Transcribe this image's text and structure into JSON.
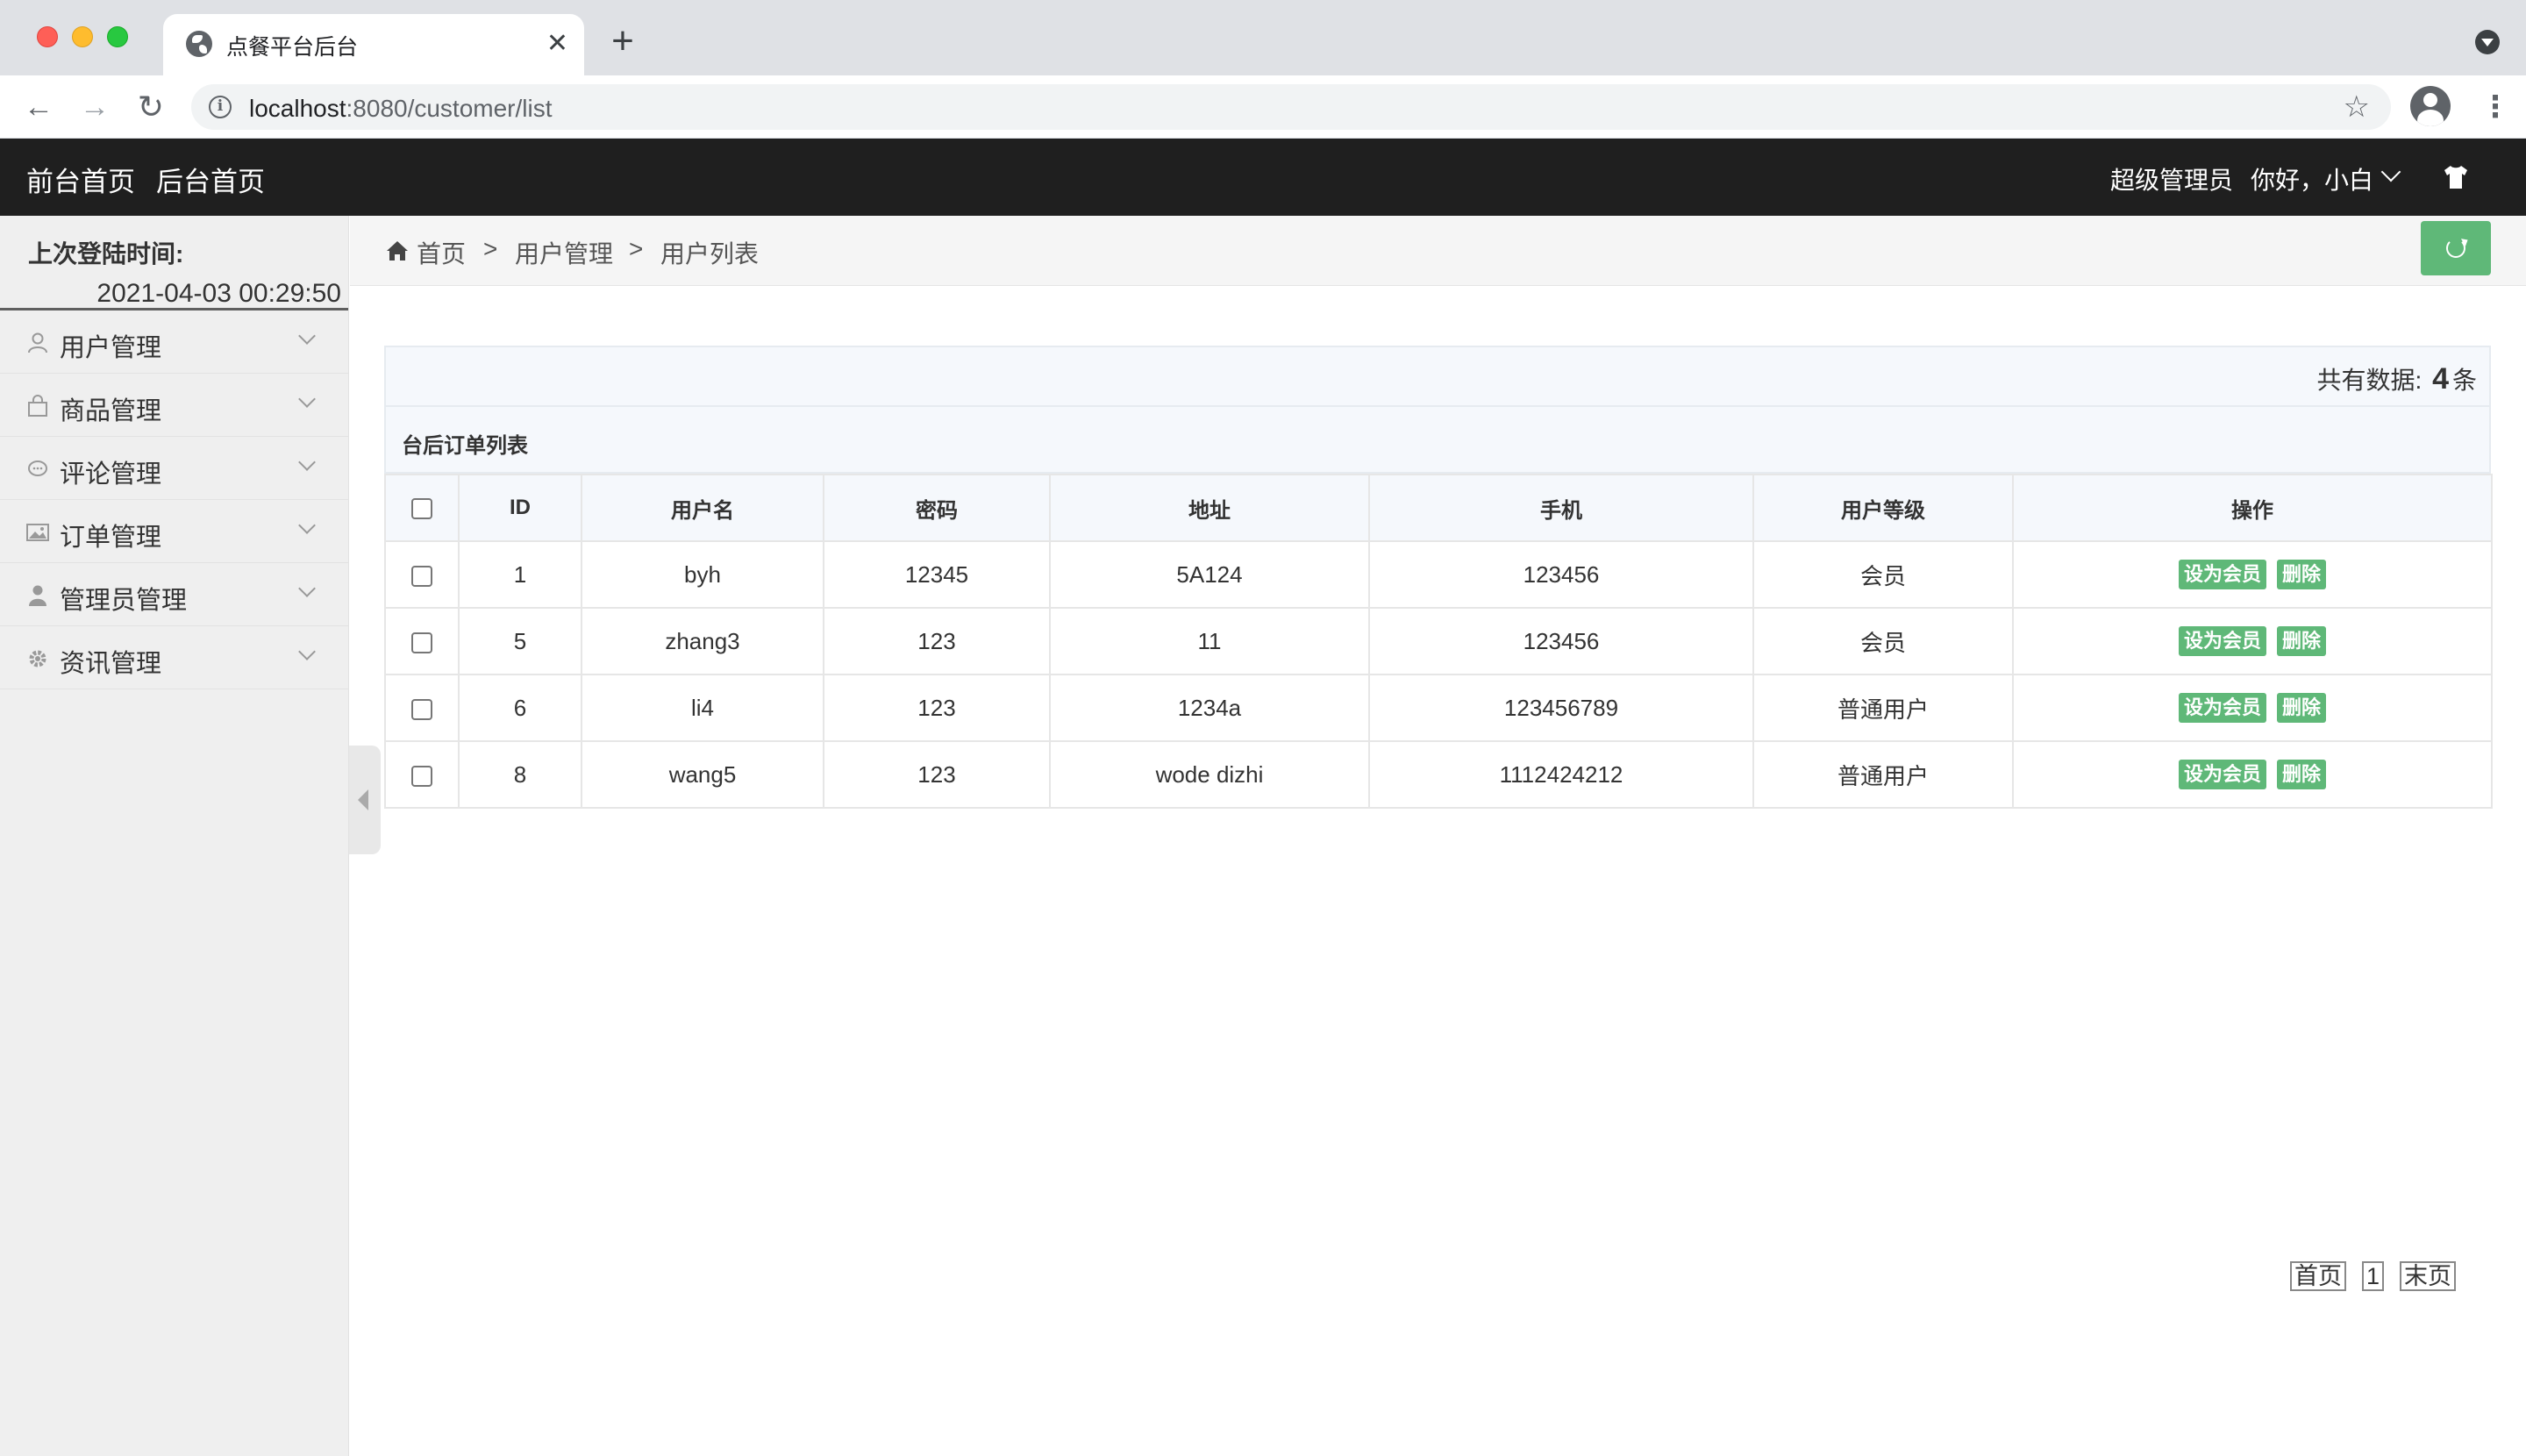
{
  "browser": {
    "tab_title": "点餐平台后台",
    "url_host": "localhost",
    "url_rest": ":8080/customer/list",
    "new_tab_symbol": "+",
    "close_symbol": "✕"
  },
  "header": {
    "front_home": "前台首页",
    "back_home": "后台首页",
    "role": "超级管理员",
    "greeting": "你好，小白"
  },
  "sidebar": {
    "login_label": "上次登陆时间:",
    "login_time": "2021-04-03 00:29:50",
    "items": [
      {
        "label": "用户管理",
        "icon": "user-icon"
      },
      {
        "label": "商品管理",
        "icon": "bag-icon"
      },
      {
        "label": "评论管理",
        "icon": "comment-icon"
      },
      {
        "label": "订单管理",
        "icon": "image-icon"
      },
      {
        "label": "管理员管理",
        "icon": "person-icon"
      },
      {
        "label": "资讯管理",
        "icon": "gear-icon"
      }
    ]
  },
  "breadcrumb": {
    "home": "首页",
    "sep": ">",
    "level1": "用户管理",
    "level2": "用户列表"
  },
  "summary": {
    "prefix": "共有数据:",
    "count": "4",
    "suffix": "条"
  },
  "table": {
    "title": "台后订单列表",
    "columns": [
      "ID",
      "用户名",
      "密码",
      "地址",
      "手机",
      "用户等级",
      "操作"
    ],
    "rows": [
      {
        "id": "1",
        "username": "byh",
        "password": "12345",
        "address": "5A124",
        "phone": "123456",
        "level": "会员"
      },
      {
        "id": "5",
        "username": "zhang3",
        "password": "123",
        "address": "11",
        "phone": "123456",
        "level": "会员"
      },
      {
        "id": "6",
        "username": "li4",
        "password": "123",
        "address": "1234a",
        "phone": "123456789",
        "level": "普通用户"
      },
      {
        "id": "8",
        "username": "wang5",
        "password": "123",
        "address": "wode dizhi",
        "phone": "1112424212",
        "level": "普通用户"
      }
    ],
    "set_member_label": "设为会员",
    "delete_label": "删除"
  },
  "pager": {
    "first": "首页",
    "page": "1",
    "last": "末页"
  },
  "colors": {
    "header_bg": "#1f1f1f",
    "accent_green": "#5fb878",
    "sidebar_bg": "#efefef"
  }
}
